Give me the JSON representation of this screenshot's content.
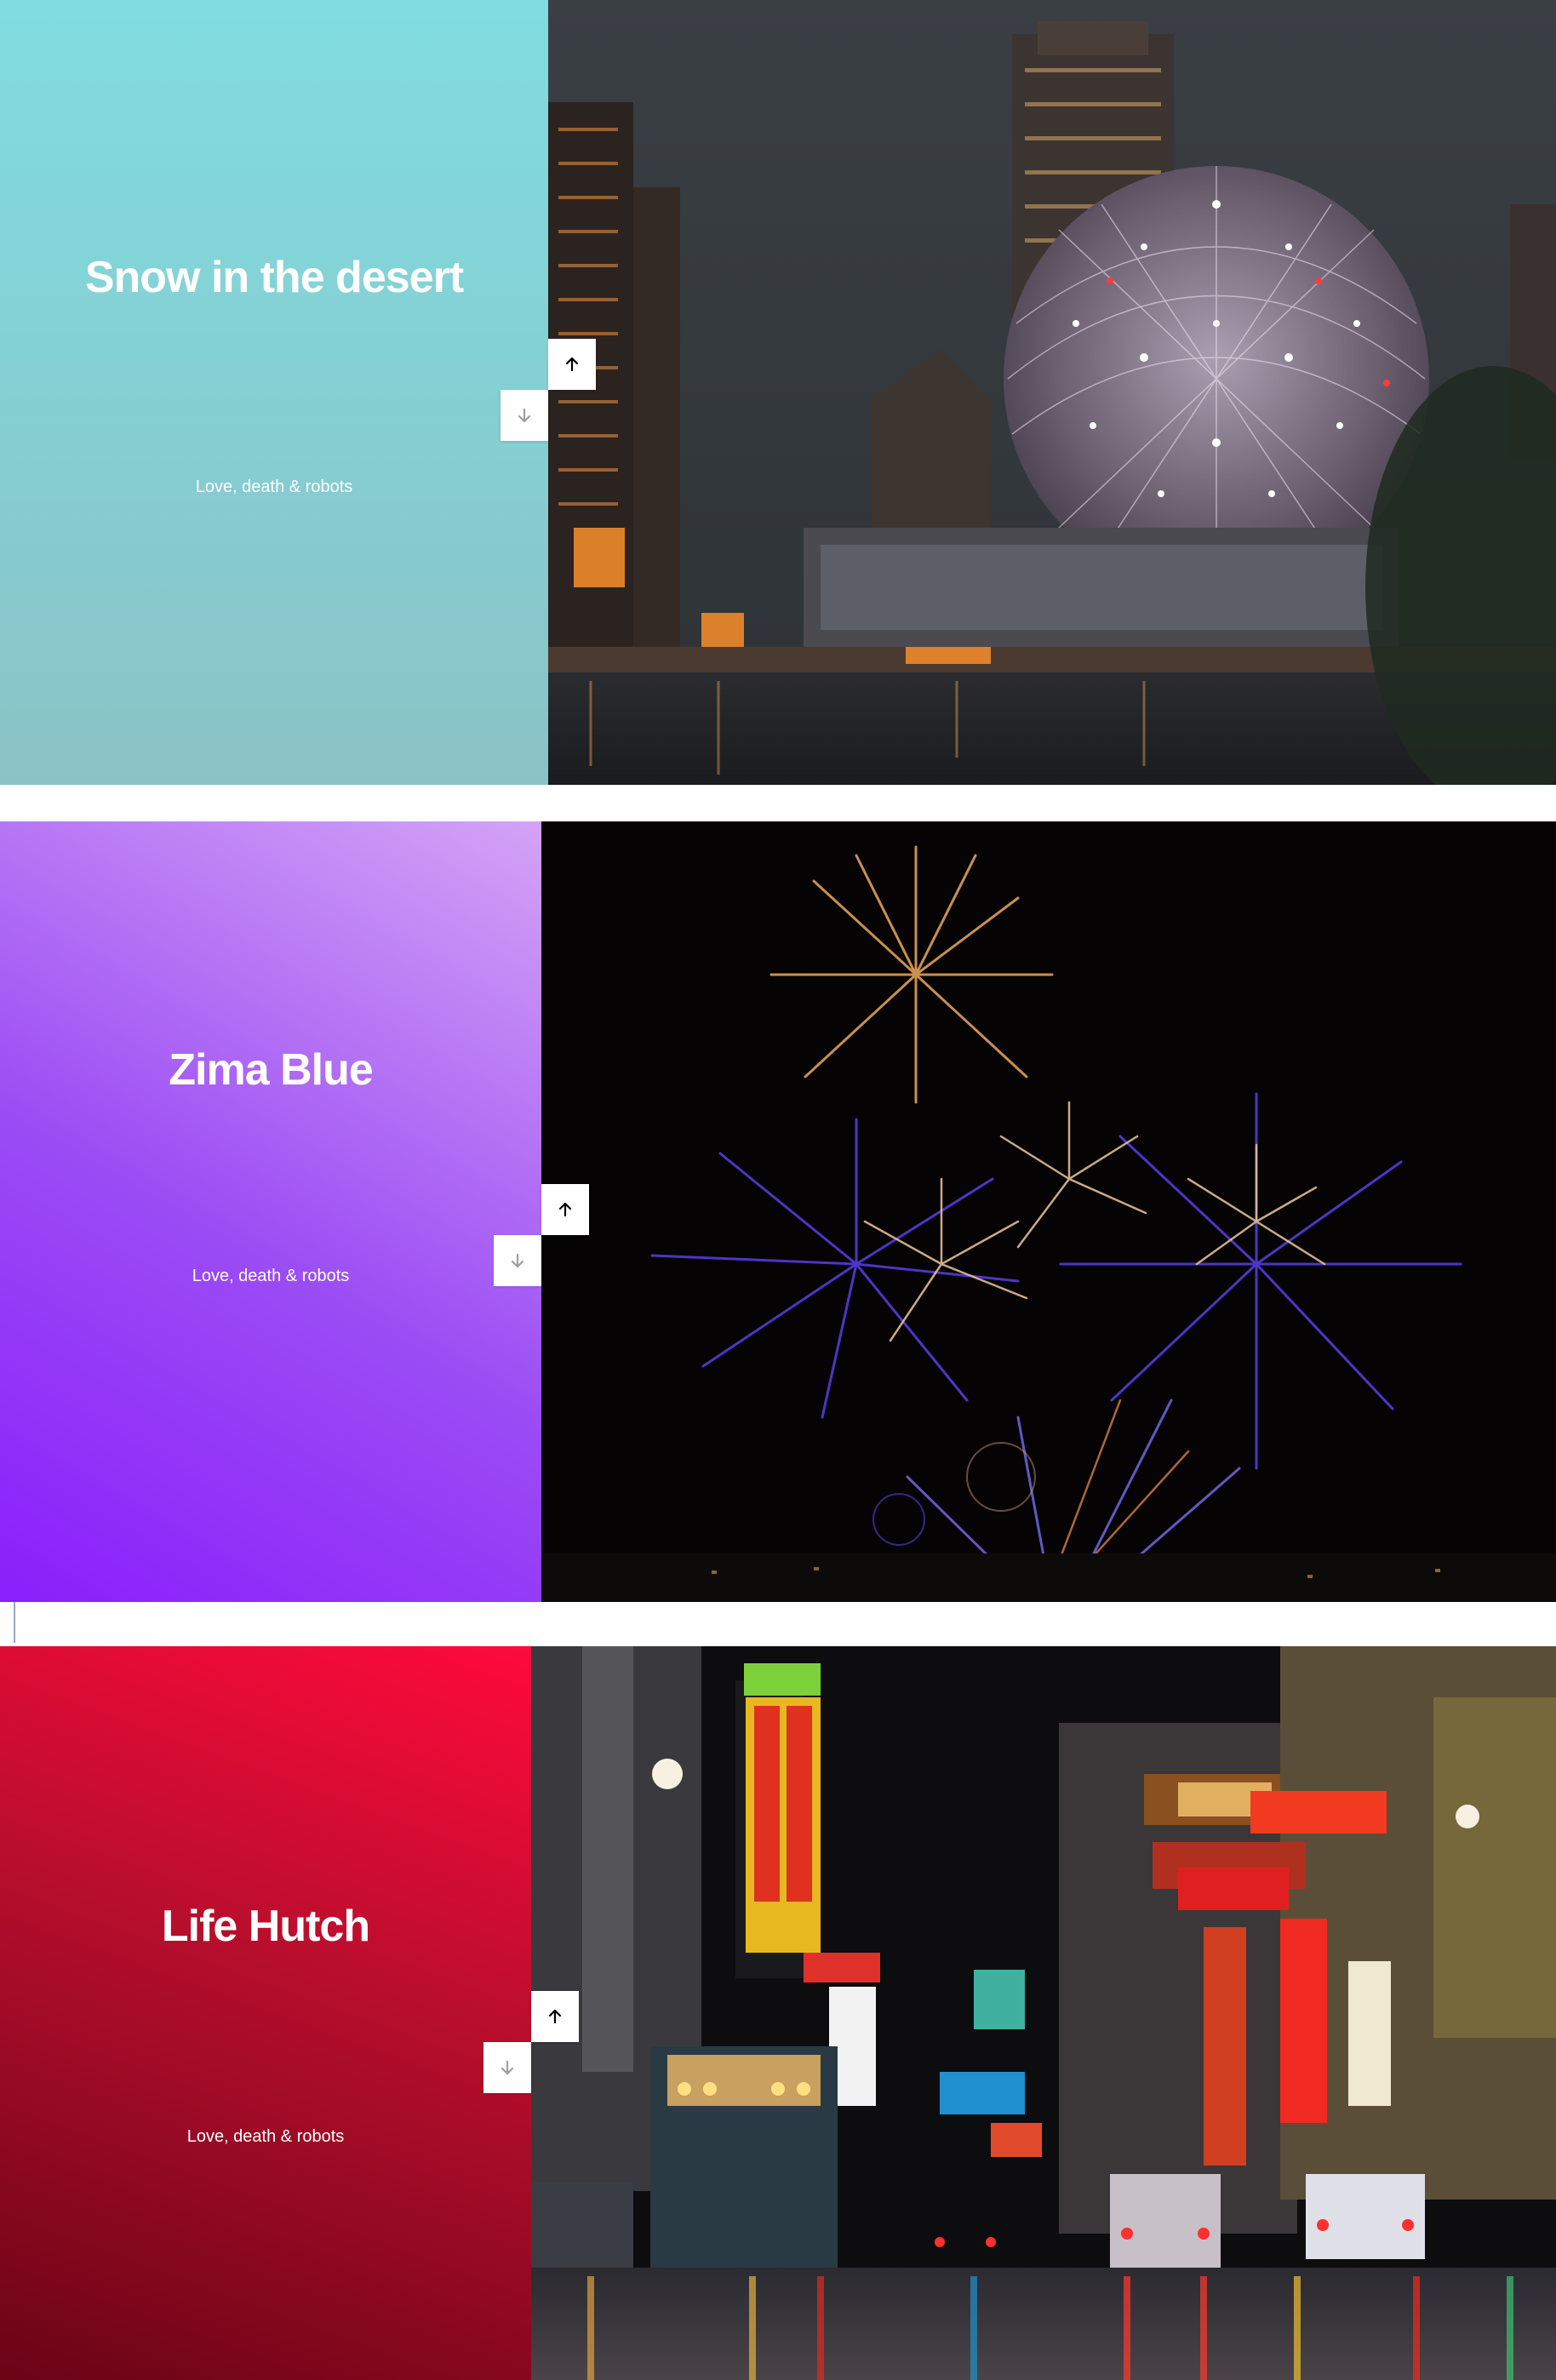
{
  "slides": [
    {
      "title": "Snow in the desert",
      "subtitle": "Love, death & robots",
      "image": "night-city-dome-photo",
      "panel_gradient": [
        "#80dce0",
        "#8ac3c6"
      ]
    },
    {
      "title": "Zima Blue",
      "subtitle": "Love, death & robots",
      "image": "fireworks-photo",
      "panel_gradient": [
        "#d4a3f5",
        "#8a1ffb"
      ]
    },
    {
      "title": "Life Hutch",
      "subtitle": "Love, death & robots",
      "image": "neon-street-photo",
      "panel_gradient": [
        "#ff0a3c",
        "#6a0416"
      ]
    }
  ],
  "controls": {
    "up_icon": "arrow-up-icon",
    "down_icon": "arrow-down-icon",
    "up_color": "#000000",
    "down_color": "#9e9e9e"
  }
}
